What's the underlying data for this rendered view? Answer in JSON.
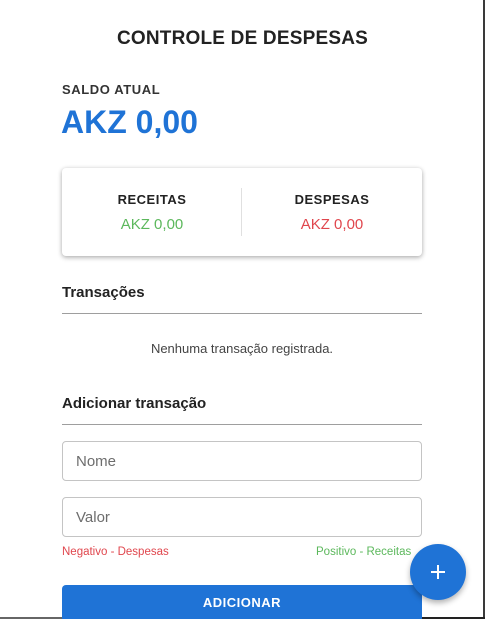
{
  "header": {
    "title": "CONTROLE DE DESPESAS"
  },
  "balance": {
    "label": "SALDO ATUAL",
    "value": "AKZ 0,00"
  },
  "summary": {
    "income_label": "RECEITAS",
    "income_value": "AKZ 0,00",
    "expense_label": "DESPESAS",
    "expense_value": "AKZ 0,00"
  },
  "transactions": {
    "title": "Transações",
    "empty_message": "Nenhuma transação registrada."
  },
  "add_form": {
    "title": "Adicionar transação",
    "name_placeholder": "Nome",
    "value_placeholder": "Valor",
    "negative_hint": "Negativo - Despesas",
    "positive_hint": "Positivo - Receitas",
    "submit_label": "ADICIONAR"
  },
  "fab": {
    "icon": "plus-icon"
  },
  "colors": {
    "primary": "#1f73d6",
    "income": "#5cb85c",
    "expense": "#e0464d"
  }
}
